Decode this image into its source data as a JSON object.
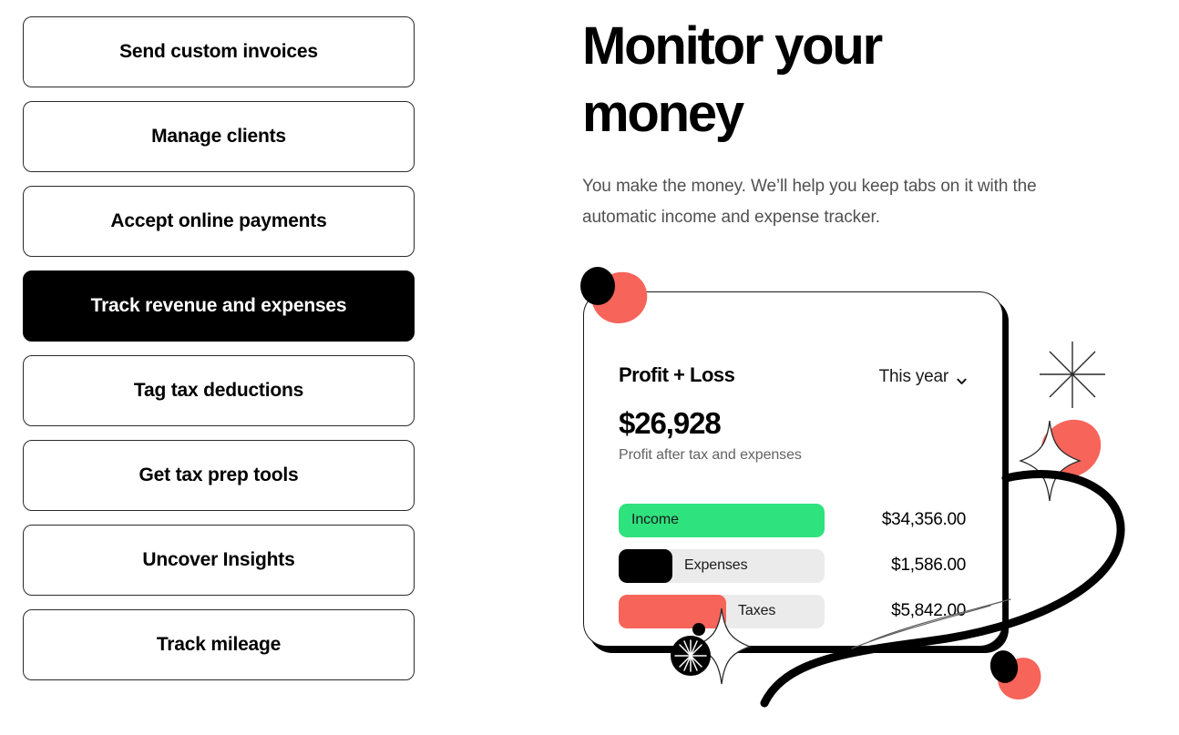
{
  "nav": {
    "items": [
      {
        "label": "Send custom invoices",
        "active": false
      },
      {
        "label": "Manage clients",
        "active": false
      },
      {
        "label": "Accept online payments",
        "active": false
      },
      {
        "label": "Track revenue and expenses",
        "active": true
      },
      {
        "label": "Tag tax deductions",
        "active": false
      },
      {
        "label": "Get tax prep tools",
        "active": false
      },
      {
        "label": "Uncover Insights",
        "active": false
      },
      {
        "label": "Track mileage",
        "active": false
      }
    ]
  },
  "hero": {
    "headline": "Monitor your money",
    "subcopy": "You make the money. We’ll help you keep tabs on it with the automatic income and expense tracker."
  },
  "card": {
    "title": "Profit + Loss",
    "period": "This year",
    "period_chevron": "chevron-down-icon",
    "amount": "$26,928",
    "amount_note": "Profit after tax and expenses"
  },
  "chart_data": {
    "type": "bar",
    "title": "Profit + Loss",
    "orientation": "horizontal",
    "categories": [
      "Income",
      "Expenses",
      "Taxes"
    ],
    "values": [
      34356.0,
      1586.0,
      5842.0
    ],
    "value_labels": [
      "$34,356.00",
      "$1,586.00",
      "$5,842.00"
    ],
    "colors": [
      "#2EE27E",
      "#000000",
      "#F7645A"
    ],
    "track_color": "#EBEBEB",
    "bar_fill_percent": [
      100,
      26,
      52
    ],
    "xlabel": "",
    "ylabel": "",
    "legend": "none",
    "grid": false
  },
  "decor": {
    "accent_red": "#F7645A",
    "accent_green": "#2EE27E",
    "ink": "#000000",
    "shapes": [
      "blob-black-top-left",
      "blob-red-top-left",
      "sparkle-8point-top-right",
      "blob-red-teardrop-right",
      "sparkle-4point-outline-right",
      "sparkle-4point-outline-bottom",
      "dot-small-black",
      "circle-spokes-black",
      "orbit-swoosh",
      "blob-black-bottom-right",
      "blob-red-bottom-right"
    ]
  }
}
